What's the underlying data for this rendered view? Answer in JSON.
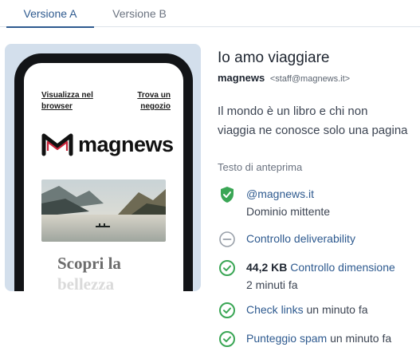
{
  "tabs": [
    {
      "label": "Versione A"
    },
    {
      "label": "Versione B"
    }
  ],
  "email": {
    "top_links": {
      "left": "Visualizza nel browser",
      "right": "Trova un negozio"
    },
    "logo_text": "magnews",
    "headline_line1": "Scopri la",
    "headline_line2": "bellezza"
  },
  "info": {
    "subject": "Io amo viaggiare",
    "sender_name": "magnews",
    "sender_email": "<staff@magnews.it>",
    "preheader": "Il mondo è un libro e chi non viaggia ne conosce solo una pagina",
    "preheader_label": "Testo di anteprima"
  },
  "checks": {
    "domain": {
      "value": "@magnews.it",
      "label": "Dominio mittente",
      "icon": "shield-check-icon"
    },
    "deliverability": {
      "label": "Controllo deliverability",
      "icon": "minus-circle-icon"
    },
    "size": {
      "value": "44,2 KB",
      "label": "Controllo dimensione",
      "time": "2 minuti fa",
      "icon": "check-circle-icon"
    },
    "links": {
      "label": "Check links",
      "time": "un minuto fa",
      "icon": "check-circle-icon"
    },
    "spam": {
      "label": "Punteggio spam",
      "time": "un minuto fa",
      "icon": "check-circle-icon"
    }
  },
  "colors": {
    "accent": "#2e5a8f",
    "success": "#3aa655",
    "neutral": "#9aa1aa",
    "brand_logo": "#c8243a"
  }
}
